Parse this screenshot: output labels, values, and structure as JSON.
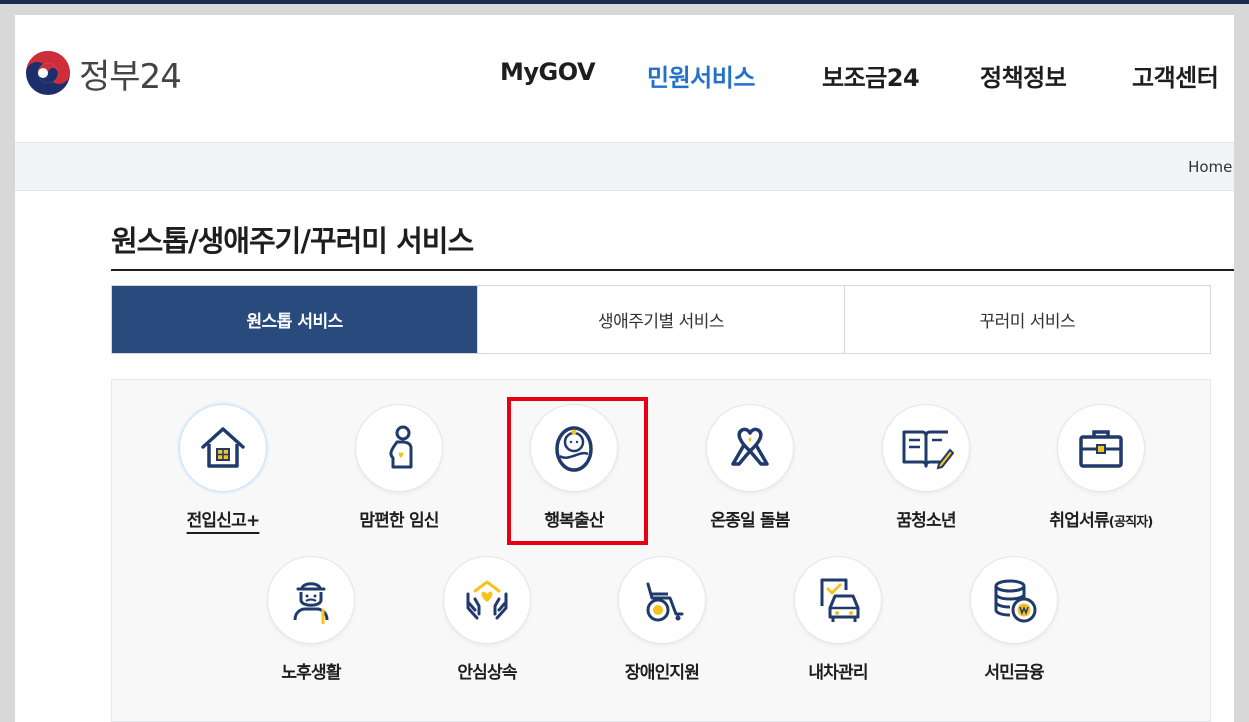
{
  "header": {
    "logo_text": "정부24",
    "nav": [
      {
        "label": "MyGOV",
        "active": false
      },
      {
        "label": "민원서비스",
        "active": true
      },
      {
        "label": "보조금24",
        "active": false
      },
      {
        "label": "정책정보",
        "active": false
      },
      {
        "label": "고객센터",
        "active": false
      }
    ]
  },
  "breadcrumb": {
    "home": "Home",
    "arrow": "›"
  },
  "page_title": "원스톱/생애주기/꾸러미 서비스",
  "tabs": [
    {
      "label": "원스톱 서비스",
      "active": true
    },
    {
      "label": "생애주기별 서비스",
      "active": false
    },
    {
      "label": "꾸러미 서비스",
      "active": false
    }
  ],
  "services_row1": [
    {
      "label": "전입신고+",
      "icon": "house-icon"
    },
    {
      "label": "맘편한 임신",
      "icon": "pregnant-icon"
    },
    {
      "label": "행복출산",
      "icon": "baby-icon"
    },
    {
      "label": "온종일 돌봄",
      "icon": "ribbon-icon"
    },
    {
      "label": "꿈청소년",
      "icon": "book-icon"
    },
    {
      "label": "취업서류",
      "label_sub": "(공직자)",
      "icon": "briefcase-icon"
    }
  ],
  "services_row2": [
    {
      "label": "노후생활",
      "icon": "elderly-icon"
    },
    {
      "label": "안심상속",
      "icon": "hands-icon"
    },
    {
      "label": "장애인지원",
      "icon": "wheelchair-icon"
    },
    {
      "label": "내차관리",
      "icon": "car-icon"
    },
    {
      "label": "서민금융",
      "icon": "coins-icon"
    }
  ],
  "colors": {
    "navy": "#294a7d",
    "icon_blue": "#1f3a6b",
    "icon_yellow": "#f5c31c",
    "active_nav": "#2372c8",
    "highlight": "#e60012"
  }
}
